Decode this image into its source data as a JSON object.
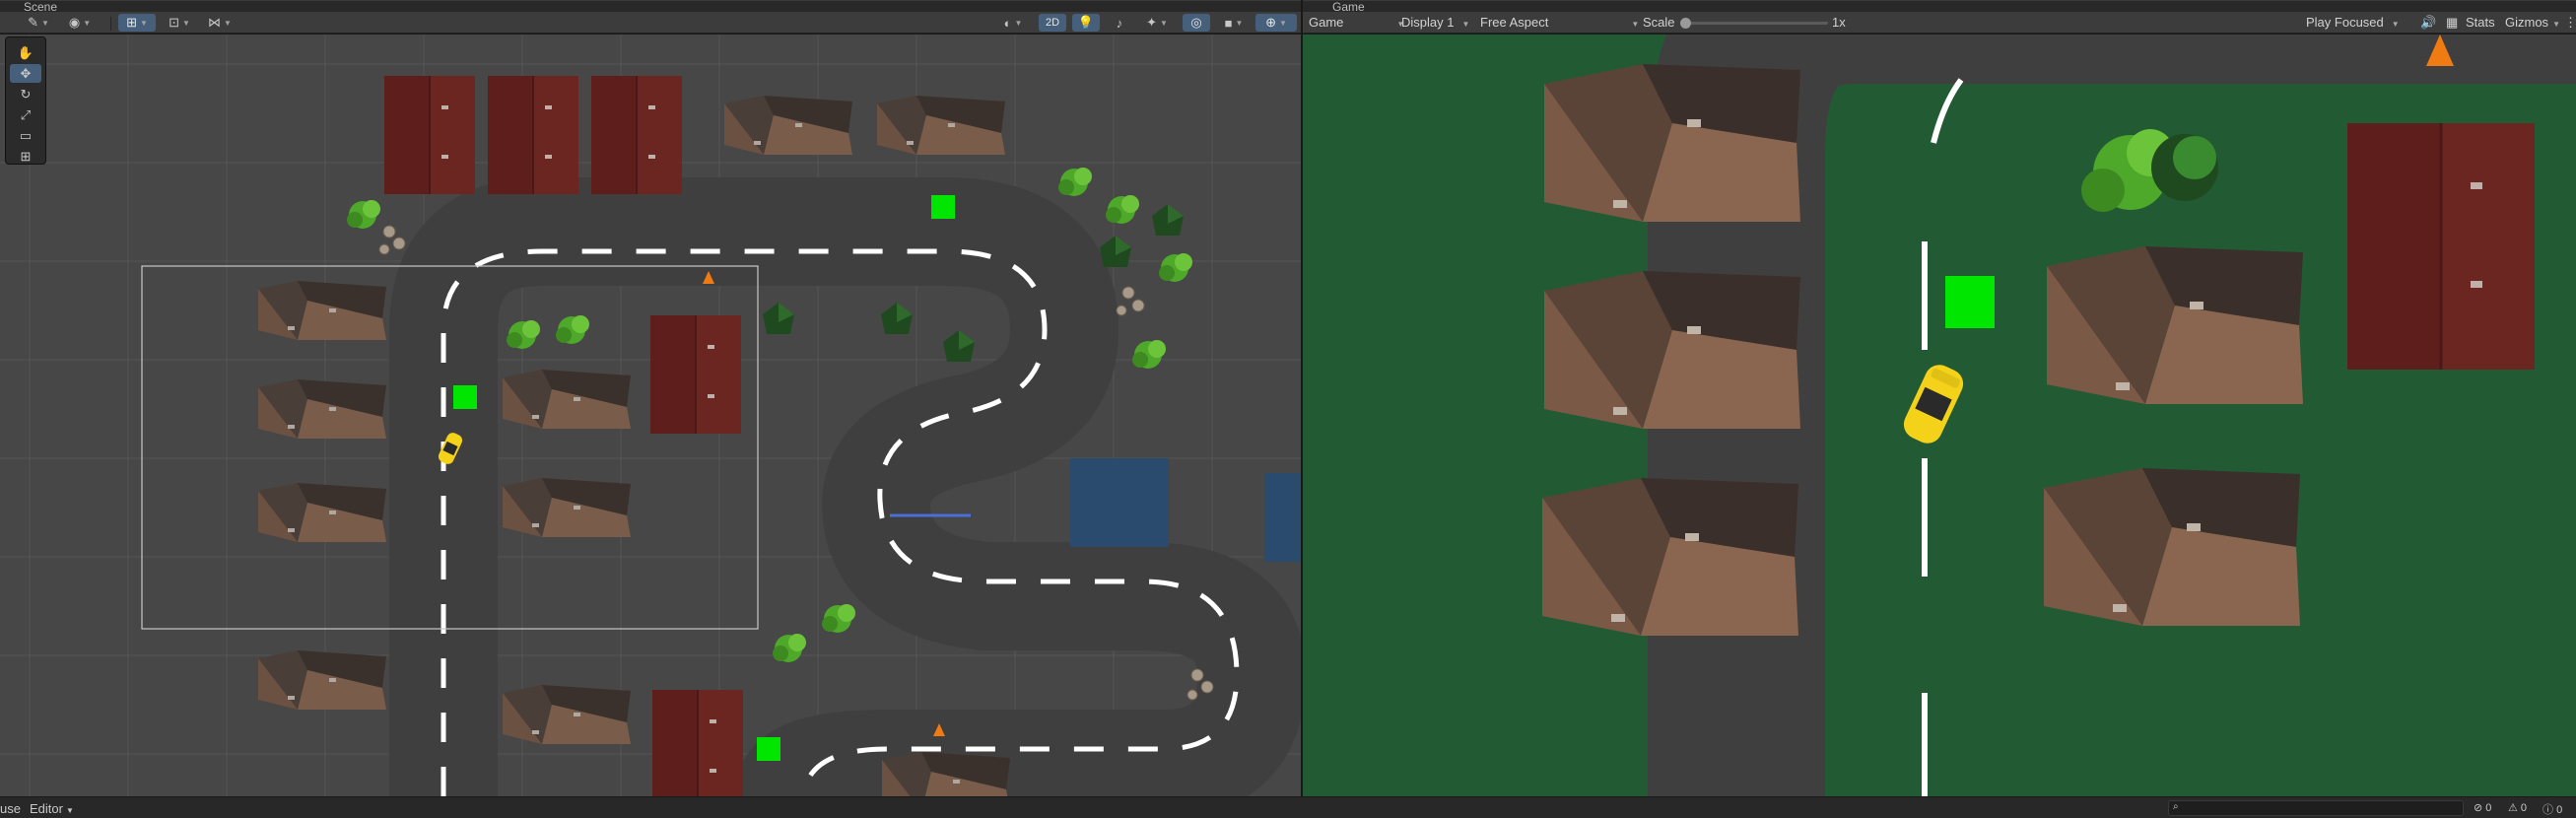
{
  "tabs": {
    "scene": "Scene",
    "game": "Game",
    "more": "⋮"
  },
  "scene_toolbar": {
    "view2d_label": "2D",
    "icons": [
      "brush-icon",
      "layers-icon",
      "grid-snap-icon",
      "increment-snap-icon",
      "align-icon",
      "shading-icon",
      "light-icon",
      "audio-icon",
      "effects-icon",
      "visibility-icon",
      "camera-icon",
      "gizmo-icon"
    ]
  },
  "game_toolbar": {
    "view_select": "Game",
    "display_select": "Display 1",
    "aspect_select": "Free Aspect",
    "scale_label": "Scale",
    "scale_value": "1x",
    "scale_fraction": 0.0,
    "play_mode_select": "Play Focused",
    "stats_label": "Stats",
    "gizmos_label": "Gizmos"
  },
  "tools": [
    "hand-tool",
    "move-tool",
    "rotate-tool",
    "scale-tool",
    "rect-tool",
    "transform-tool"
  ],
  "status": {
    "left_label": "use",
    "mode_select": "Editor",
    "search_placeholder": "",
    "errors": "0",
    "warnings": "0",
    "messages": "0"
  },
  "colors": {
    "accent": "#46607c",
    "road": "#3f3f3f",
    "grass": "#225b33",
    "pickup": "#00e600",
    "cone": "#f07b12",
    "car": "#f4d21a"
  }
}
